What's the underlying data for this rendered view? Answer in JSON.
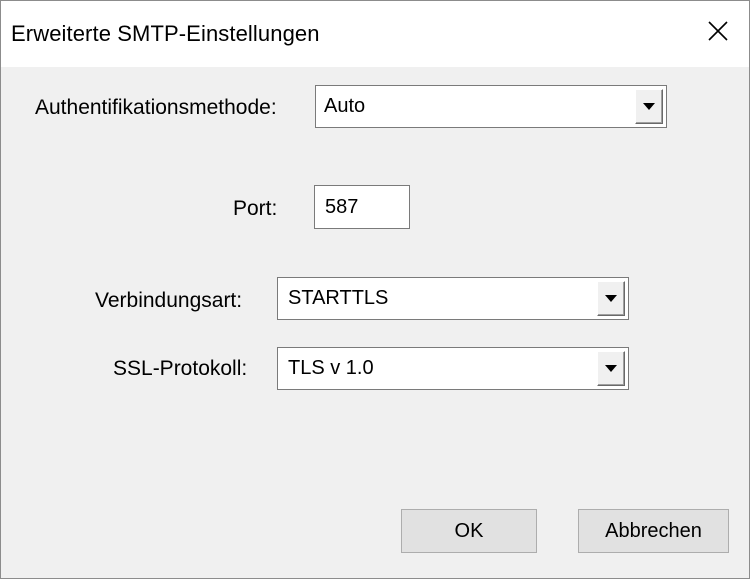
{
  "dialog": {
    "title": "Erweiterte SMTP-Einstellungen",
    "close_label": "×"
  },
  "fields": {
    "auth_label": "Authentifikationsmethode:",
    "auth_value": "Auto",
    "port_label": "Port:",
    "port_value": "587",
    "connection_label": "Verbindungsart:",
    "connection_value": "STARTTLS",
    "ssl_label": "SSL-Protokoll:",
    "ssl_value": "TLS v 1.0"
  },
  "buttons": {
    "ok_label": "OK",
    "cancel_label": "Abbrechen"
  },
  "icons": {
    "close": "close-icon",
    "dropdown": "chevron-down-icon"
  }
}
